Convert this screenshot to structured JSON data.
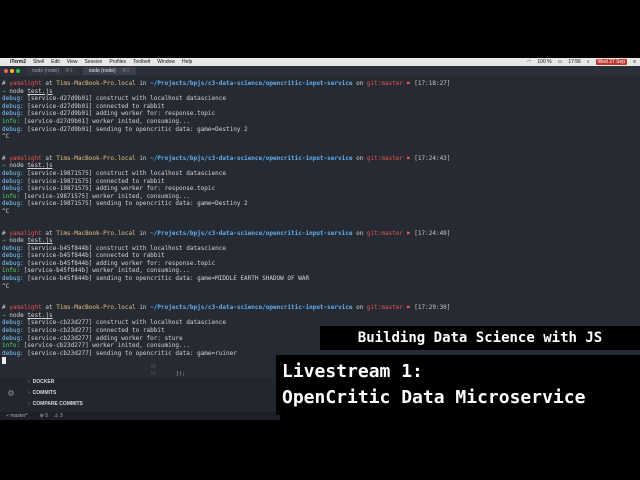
{
  "menubar": {
    "app": "iTerm2",
    "items": [
      "Shell",
      "Edit",
      "View",
      "Session",
      "Profiles",
      "Toolbelt",
      "Window",
      "Help"
    ],
    "battery": "100 %",
    "time": "17:56",
    "date": "Wed 27 Sep"
  },
  "tabs": [
    {
      "label": "node (node)",
      "shortcut": "⌘1",
      "active": false
    },
    {
      "label": "node (node)",
      "shortcut": "⌘2",
      "active": true
    }
  ],
  "prompt": {
    "symbol": "#",
    "user": "yamalight",
    "at": " at ",
    "host": "Tims-MacBook-Pro.local",
    "in": " in ",
    "path": "~/Projects/bpjs/c3-data-science/opencritic-input-service",
    "on": " on ",
    "git": "git:master",
    "x": "✖",
    "arrow": "→",
    "cmd": "node ",
    "file": "test.js"
  },
  "sessions": [
    {
      "time": "[17:18:27]",
      "logs": [
        {
          "level": "debug:",
          "text": " [service-d27d9b01] construct with localhost datascience"
        },
        {
          "level": "debug:",
          "text": " [service-d27d9b01] connected to rabbit"
        },
        {
          "level": "debug:",
          "text": " [service-d27d9b01] adding worker for: response.topic"
        },
        {
          "level": "info:",
          "text": " [service-d27d9b01] worker inited, consuming..."
        },
        {
          "level": "debug:",
          "text": " [service-d27d9b01] sending to opencritic data: game=Destiny 2"
        }
      ],
      "end": "^C"
    },
    {
      "time": "[17:24:43]",
      "logs": [
        {
          "level": "debug:",
          "text": " [service-19871575] construct with localhost datascience"
        },
        {
          "level": "debug:",
          "text": " [service-19871575] connected to rabbit"
        },
        {
          "level": "debug:",
          "text": " [service-19871575] adding worker for: response.topic"
        },
        {
          "level": "info:",
          "text": " [service-19871575] worker inited, consuming..."
        },
        {
          "level": "debug:",
          "text": " [service-19871575] sending to opencritic data: game=Destiny 2"
        }
      ],
      "end": "^C"
    },
    {
      "time": "[17:24:49]",
      "logs": [
        {
          "level": "debug:",
          "text": " [service-b45f844b] construct with localhost datascience"
        },
        {
          "level": "debug:",
          "text": " [service-b45f844b] connected to rabbit"
        },
        {
          "level": "debug:",
          "text": " [service-b45f844b] adding worker for: response.topic"
        },
        {
          "level": "info:",
          "text": " [service-b45f844b] worker inited, consuming..."
        },
        {
          "level": "debug:",
          "text": " [service-b45f844b] sending to opencritic data: game=MIDDLE EARTH SHADOW OF WAR"
        }
      ],
      "end": "^C"
    },
    {
      "time": "[17:29:30]",
      "logs": [
        {
          "level": "debug:",
          "text": " [service-cb23d277] construct with localhost datascience"
        },
        {
          "level": "debug:",
          "text": " [service-cb23d277] connected to rabbit"
        },
        {
          "level": "debug:",
          "text": " [service-cb23d277] adding worker for: sture"
        },
        {
          "level": "info:",
          "text": " [service-cb23d277] worker inited, consuming..."
        },
        {
          "level": "debug:",
          "text": " [service-cb23d277] sending to opencritic data: game=ruiner"
        }
      ],
      "end": ""
    }
  ],
  "sidebar": {
    "items": [
      "DOCKER",
      "COMMITS",
      "COMPARE COMMITS"
    ],
    "line_numbers": [
      "38",
      "39"
    ],
    "line_text": "});"
  },
  "statusbar": {
    "branch": "master*",
    "errors": "⊗ 5",
    "warnings": "⚠ 3"
  },
  "overlay": {
    "series": "Building Data Science with JS",
    "episode_line1": "Livestream 1:",
    "episode_line2": "OpenCritic Data Microservice"
  }
}
